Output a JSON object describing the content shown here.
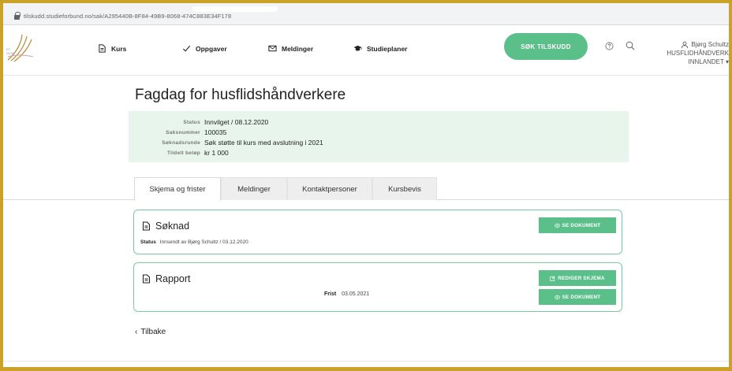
{
  "browser": {
    "url": "tilskudd.studieforbund.no/sak/A295440B-8F84-49B9-8068-474C883E34F178"
  },
  "nav": {
    "items": [
      {
        "label": "Kurs",
        "icon": "document-icon"
      },
      {
        "label": "Oppgaver",
        "icon": "check-icon"
      },
      {
        "label": "Meldinger",
        "icon": "mail-icon"
      },
      {
        "label": "Studieplaner",
        "icon": "graduation-cap-icon"
      }
    ],
    "apply_button": "SØK TILSKUDD"
  },
  "user": {
    "name": "Bjørg Schultz",
    "org_line1": "HUSFLIDHÅNDVERK",
    "org_line2": "INNLANDET"
  },
  "case": {
    "title": "Fagdag for husflidshåndverkere",
    "info": [
      {
        "label": "Status",
        "value": "Innvilget / 08.12.2020"
      },
      {
        "label": "Saksnummer",
        "value": "100035"
      },
      {
        "label": "Søknadsrunde",
        "value": "Søk støtte til kurs med avslutning i 2021"
      },
      {
        "label": "Tildelt beløp",
        "value": "kr 1 000"
      }
    ]
  },
  "tabs": [
    {
      "label": "Skjema og frister",
      "active": true
    },
    {
      "label": "Meldinger",
      "active": false
    },
    {
      "label": "Kontaktpersoner",
      "active": false
    },
    {
      "label": "Kursbevis",
      "active": false
    }
  ],
  "cards": {
    "soknad": {
      "title": "Søknad",
      "status_label": "Status",
      "status_value": "Innsendt av Bjørg Schultz / 03.12.2020",
      "button": "SE DOKUMENT"
    },
    "rapport": {
      "title": "Rapport",
      "frist_label": "Frist",
      "frist_value": "03.05.2021",
      "edit_button": "REDIGER SKJEMA",
      "view_button": "SE DOKUMENT"
    }
  },
  "back_label": "Tilbake",
  "colors": {
    "accent_green": "#5bbf8a",
    "info_bg": "#e8f5ec",
    "frame": "#c9a227"
  }
}
